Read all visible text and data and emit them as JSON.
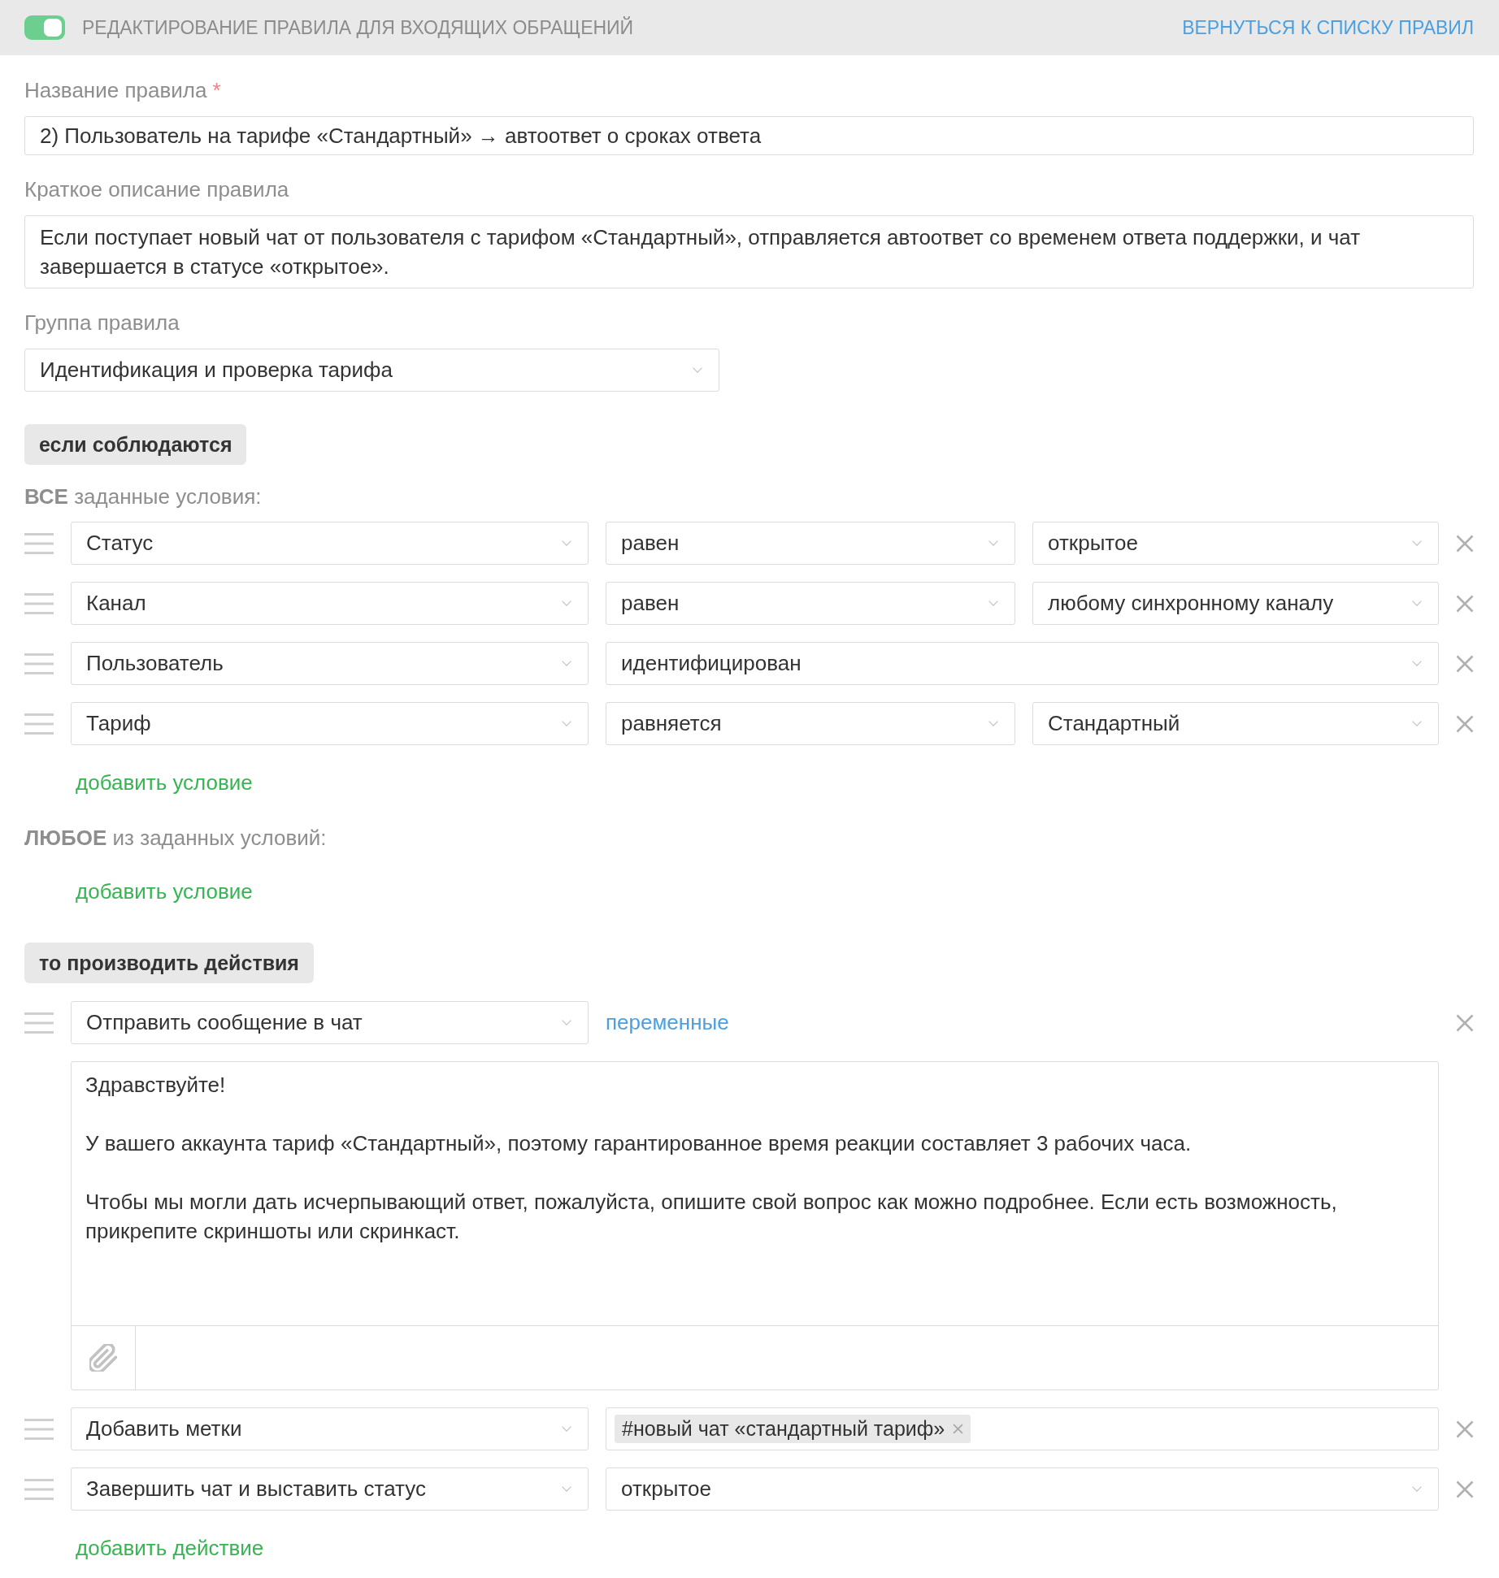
{
  "header": {
    "toggle_on": true,
    "title": "РЕДАКТИРОВАНИЕ ПРАВИЛА ДЛЯ ВХОДЯЩИХ ОБРАЩЕНИЙ",
    "back_link": "ВЕРНУТЬСЯ К СПИСКУ ПРАВИЛ"
  },
  "rule_name": {
    "label": "Название правила",
    "required_mark": "*",
    "value": "2) Пользователь на тарифе «Стандартный» → автоответ о сроках ответа"
  },
  "description": {
    "label": "Краткое описание правила",
    "value": "Если поступает новый чат от пользователя с тарифом «Стандартный», отправляется автоответ со временем ответа поддержки, и чат завершается в статусе «открытое»."
  },
  "group": {
    "label": "Группа правила",
    "value": "Идентификация и проверка тарифа"
  },
  "conditions": {
    "heading": "если соблюдаются",
    "all": {
      "title": "**ВСЕ** заданные условия:",
      "rows": [
        {
          "field": "Статус",
          "operator": "равен",
          "value": "открытое"
        },
        {
          "field": "Канал",
          "operator": "равен",
          "value": "любому синхронному каналу"
        },
        {
          "field": "Пользователь",
          "operator": "идентифицирован"
        },
        {
          "field": "Тариф",
          "operator": "равняется",
          "value": "Стандартный"
        }
      ],
      "add_link": "добавить условие"
    },
    "any": {
      "title": "**ЛЮБОЕ** из заданных условий:",
      "add_link": "добавить условие"
    }
  },
  "actions": {
    "heading": "то производить действия",
    "rows": [
      {
        "kind": "message",
        "action": "Отправить сообщение в чат",
        "variables_link": "переменные",
        "message": "Здравствуйте!\n\nУ вашего аккаунта тариф «Стандартный», поэтому гарантированное время реакции составляет 3 рабочих часа.\n\nЧтобы мы могли дать исчерпывающий ответ, пожалуйста, опишите свой вопрос как можно подробнее. Если есть возможность, прикрепите скриншоты или скринкаст."
      },
      {
        "kind": "tags",
        "action": "Добавить метки",
        "tags": [
          "#новый чат «стандартный тариф»"
        ]
      },
      {
        "kind": "select",
        "action": "Завершить чат и выставить статус",
        "value": "открытое"
      }
    ],
    "add_link": "добавить действие"
  }
}
